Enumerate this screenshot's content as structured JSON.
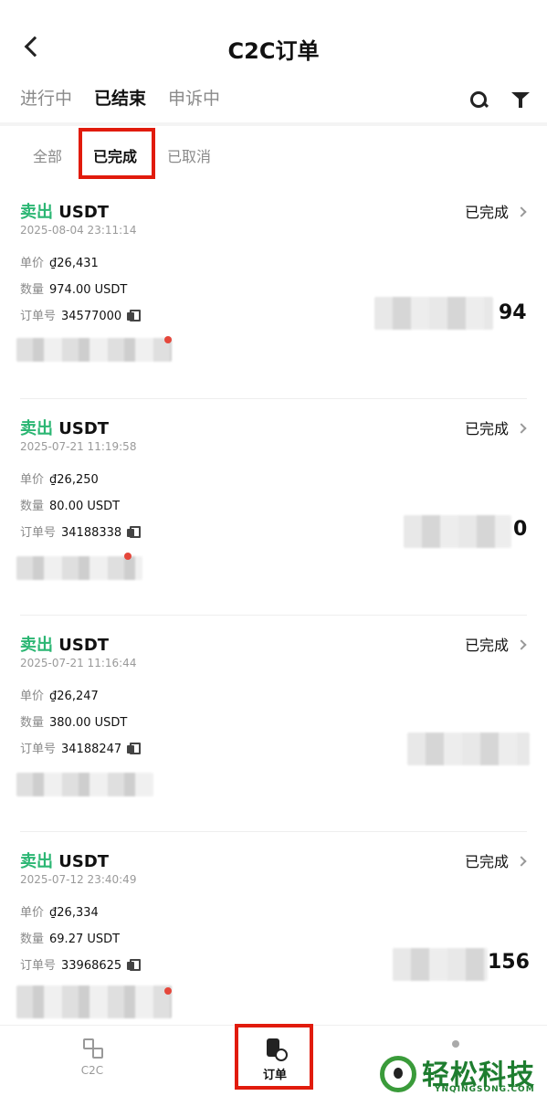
{
  "header": {
    "title": "C2C订单"
  },
  "tabs": [
    {
      "label": "进行中"
    },
    {
      "label": "已结束"
    },
    {
      "label": "申诉中"
    }
  ],
  "subtabs": [
    {
      "label": "全部"
    },
    {
      "label": "已完成"
    },
    {
      "label": "已取消"
    }
  ],
  "labels": {
    "price": "单价",
    "quantity": "数量",
    "order_no": "订单号"
  },
  "orders": [
    {
      "side": "卖出",
      "coin": "USDT",
      "time": "2025-08-04 23:11:14",
      "status": "已完成",
      "price": "₫26,431",
      "quantity": "974.00 USDT",
      "order_no": "34577000",
      "tail": "94"
    },
    {
      "side": "卖出",
      "coin": "USDT",
      "time": "2025-07-21 11:19:58",
      "status": "已完成",
      "price": "₫26,250",
      "quantity": "80.00 USDT",
      "order_no": "34188338",
      "tail": "0"
    },
    {
      "side": "卖出",
      "coin": "USDT",
      "time": "2025-07-21 11:16:44",
      "status": "已完成",
      "price": "₫26,247",
      "quantity": "380.00 USDT",
      "order_no": "34188247",
      "tail": ""
    },
    {
      "side": "卖出",
      "coin": "USDT",
      "time": "2025-07-12 23:40:49",
      "status": "已完成",
      "price": "₫26,334",
      "quantity": "69.27 USDT",
      "order_no": "33968625",
      "tail": "156"
    }
  ],
  "nav": {
    "c2c": "C2C",
    "orders": "订单"
  },
  "watermark": {
    "text": "轻松科技",
    "sub": "YNQINGSONG.COM"
  },
  "colors": {
    "buy_sell_accent": "#2bb673",
    "highlight_box": "#e11b0c",
    "watermark": "#1e7d2f"
  }
}
